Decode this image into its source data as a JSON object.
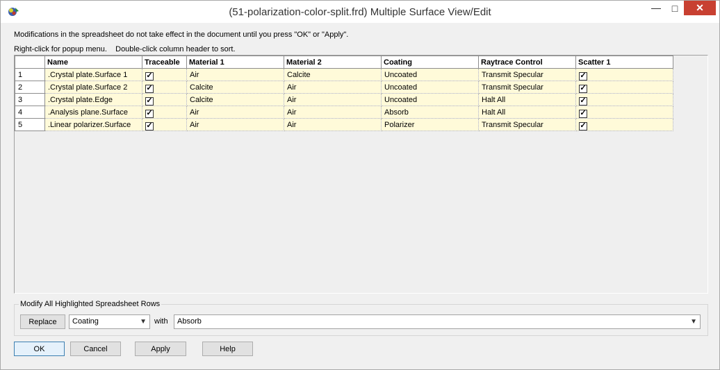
{
  "window": {
    "title": "(51-polarization-color-split.frd) Multiple Surface View/Edit",
    "minimize_glyph": "—",
    "maximize_glyph": "□",
    "close_glyph": "✕"
  },
  "hints": {
    "line1": "Modifications in the spreadsheet do not take effect in the document until you press \"OK\" or \"Apply\".",
    "line2": "Right-click for popup menu.    Double-click column header to sort."
  },
  "grid": {
    "columns": [
      "Name",
      "Traceable",
      "Material 1",
      "Material 2",
      "Coating",
      "Raytrace Control",
      "Scatter 1"
    ],
    "rows": [
      {
        "num": "1",
        "name": ".Crystal plate.Surface 1",
        "traceable": true,
        "material1": "Air",
        "material2": "Calcite",
        "coating": "Uncoated",
        "raytrace": "Transmit Specular",
        "scatter1": true
      },
      {
        "num": "2",
        "name": ".Crystal plate.Surface 2",
        "traceable": true,
        "material1": "Calcite",
        "material2": "Air",
        "coating": "Uncoated",
        "raytrace": "Transmit Specular",
        "scatter1": true
      },
      {
        "num": "3",
        "name": ".Crystal plate.Edge",
        "traceable": true,
        "material1": "Calcite",
        "material2": "Air",
        "coating": "Uncoated",
        "raytrace": "Halt All",
        "scatter1": true
      },
      {
        "num": "4",
        "name": ".Analysis plane.Surface",
        "traceable": true,
        "material1": "Air",
        "material2": "Air",
        "coating": "Absorb",
        "raytrace": "Halt All",
        "scatter1": true
      },
      {
        "num": "5",
        "name": ".Linear polarizer.Surface",
        "traceable": true,
        "material1": "Air",
        "material2": "Air",
        "coating": "Polarizer",
        "raytrace": "Transmit Specular",
        "scatter1": true
      }
    ]
  },
  "modify": {
    "group_title": "Modify All Highlighted Spreadsheet Rows",
    "replace_label": "Replace",
    "field_value": "Coating",
    "with_label": "with",
    "with_value": "Absorb"
  },
  "buttons": {
    "ok": "OK",
    "cancel": "Cancel",
    "apply": "Apply",
    "help": "Help"
  },
  "colors": {
    "row_bg": "#fffad9",
    "close_bg": "#c84031"
  }
}
